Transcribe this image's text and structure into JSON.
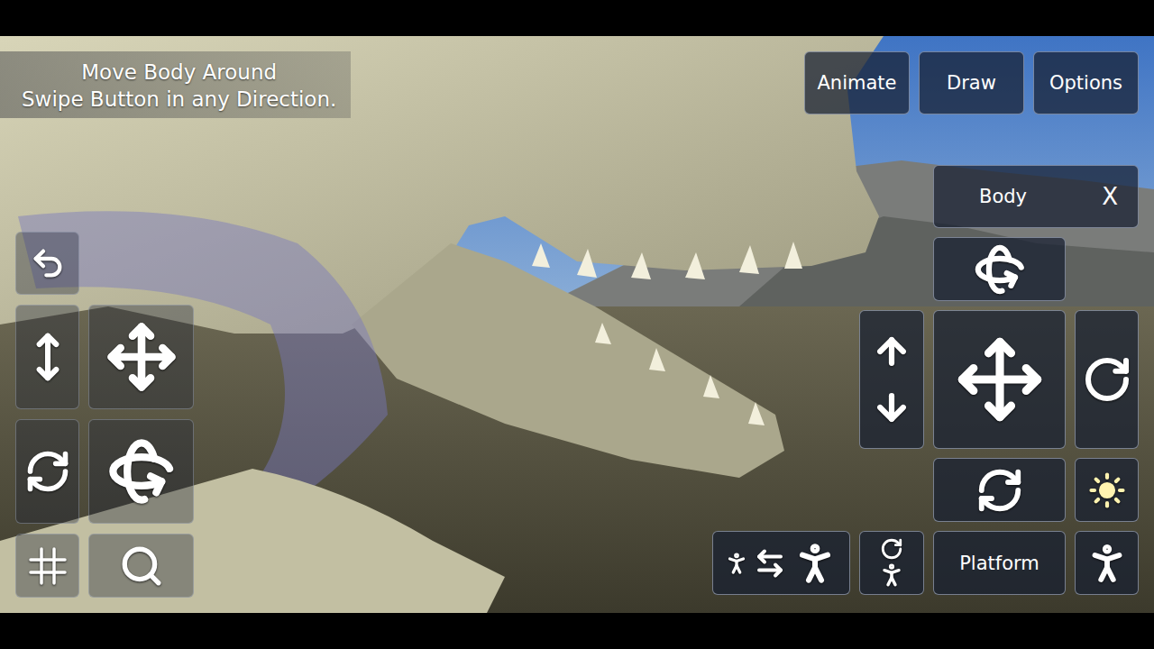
{
  "hint": {
    "lines": [
      "Move Body Around",
      "Swipe Button in any Direction."
    ]
  },
  "top_buttons": [
    "Animate",
    "Draw",
    "Options"
  ],
  "panel": {
    "title": "Body",
    "close": "X"
  },
  "platform_button": "Platform"
}
